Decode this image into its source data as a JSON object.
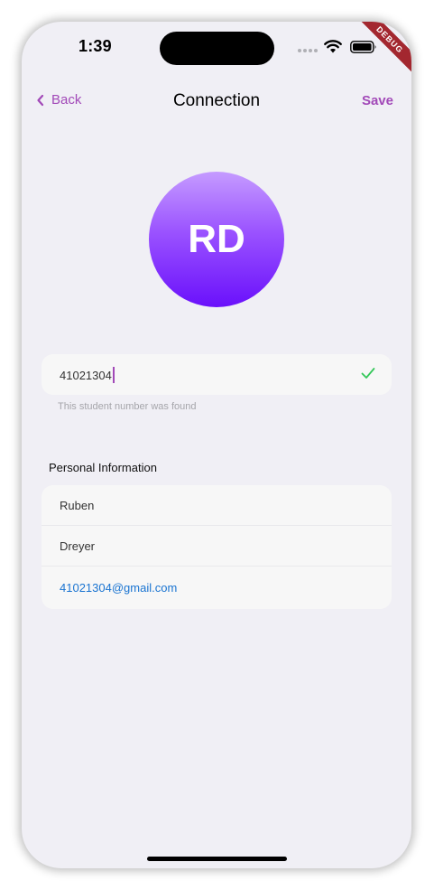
{
  "status_bar": {
    "time": "1:39"
  },
  "debug_banner": "DEBUG",
  "nav": {
    "back_label": "Back",
    "title": "Connection",
    "save_label": "Save"
  },
  "avatar": {
    "initials": "RD"
  },
  "student_number": {
    "value": "41021304",
    "helper": "This student number was found",
    "status_icon": "check-icon"
  },
  "personal_information": {
    "title": "Personal Information",
    "first_name": "Ruben",
    "last_name": "Dreyer",
    "email": "41021304@gmail.com"
  },
  "colors": {
    "accent": "#a249b8",
    "success": "#34c759",
    "link": "#1a74d1",
    "background": "#f0eff5",
    "card": "#f7f7f7"
  }
}
